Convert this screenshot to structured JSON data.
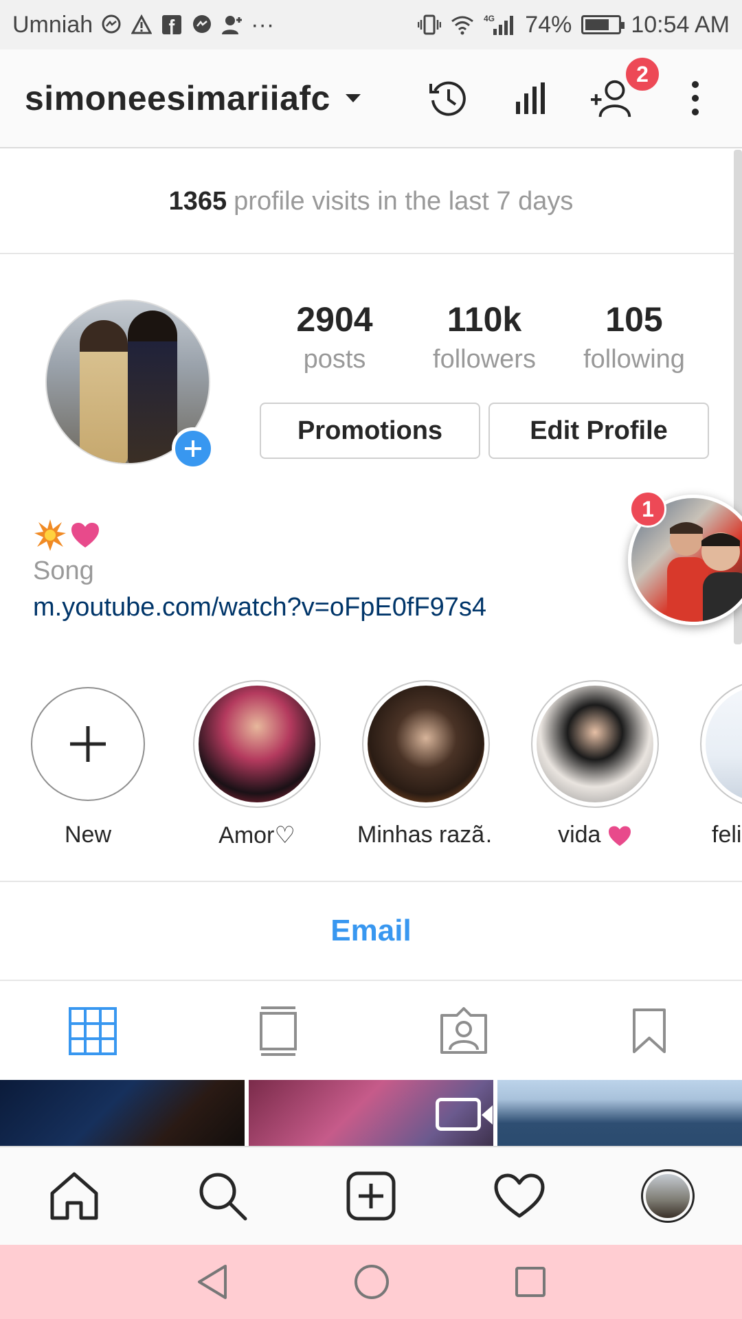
{
  "status_bar": {
    "carrier": "Umniah",
    "network": "4G",
    "battery": "74%",
    "battery_level": 0.74,
    "time": "10:54 AM"
  },
  "header": {
    "username": "simoneesimariiafc",
    "notification_badge": "2"
  },
  "visits": {
    "count": "1365",
    "text": "profile visits in the last 7 days"
  },
  "profile": {
    "stats": [
      {
        "value": "2904",
        "label": "posts"
      },
      {
        "value": "110k",
        "label": "followers"
      },
      {
        "value": "105",
        "label": "following"
      }
    ],
    "promotions_label": "Promotions",
    "edit_profile_label": "Edit Profile",
    "bio": {
      "emojis": [
        "collision-emoji",
        "heart-emoji"
      ],
      "line": "Song",
      "link": "m.youtube.com/watch?v=oFpE0fF97s4"
    }
  },
  "floating_bubble": {
    "badge": "1"
  },
  "highlights": [
    {
      "label": "New",
      "kind": "new"
    },
    {
      "label": "Amor♡",
      "kind": "story",
      "color": "#b43a5e"
    },
    {
      "label": "Minhas razã…",
      "kind": "story",
      "color": "#4a3326"
    },
    {
      "label": "vida",
      "kind": "story",
      "color": "#8a8a8a"
    },
    {
      "label": "feli",
      "kind": "story",
      "color": "#e8eef5"
    }
  ],
  "email_label": "Email",
  "view_tabs": [
    "grid-icon",
    "feed-icon",
    "tagged-icon",
    "saved-icon"
  ],
  "colors": {
    "accent": "#3897f0",
    "badge": "#ed4956",
    "link": "#003569",
    "android_nav_bg": "#ffcdd2"
  }
}
